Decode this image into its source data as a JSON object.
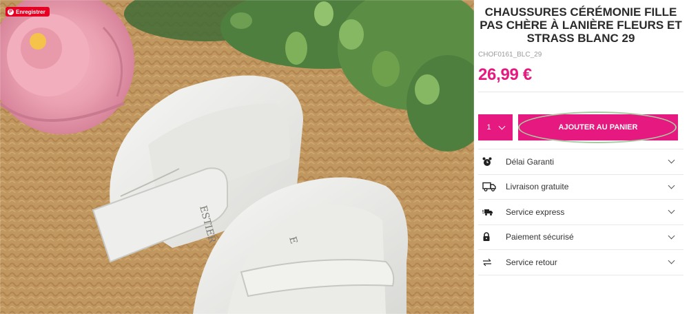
{
  "pin_button": {
    "label": "Enregistrer",
    "icon": "pinterest-icon",
    "color": "#e60023"
  },
  "product": {
    "title": "CHAUSSURES CÉRÉMONIE FILLE PAS CHÈRE À LANIÈRE FLEURS ET STRASS BLANC 29",
    "sku": "CHOF0161_BLC_29",
    "price": "26,99 €",
    "accent_color": "#e5197f"
  },
  "cart": {
    "quantity": "1",
    "add_label": "AJOUTER AU PANIER"
  },
  "accordion": {
    "items": [
      {
        "label": "Délai Garanti",
        "icon": "alarm-clock-icon"
      },
      {
        "label": "Livraison gratuite",
        "icon": "delivery-truck-icon"
      },
      {
        "label": "Service express",
        "icon": "express-truck-icon"
      },
      {
        "label": "Paiement sécurisé",
        "icon": "lock-icon"
      },
      {
        "label": "Service retour",
        "icon": "exchange-arrows-icon"
      }
    ]
  }
}
